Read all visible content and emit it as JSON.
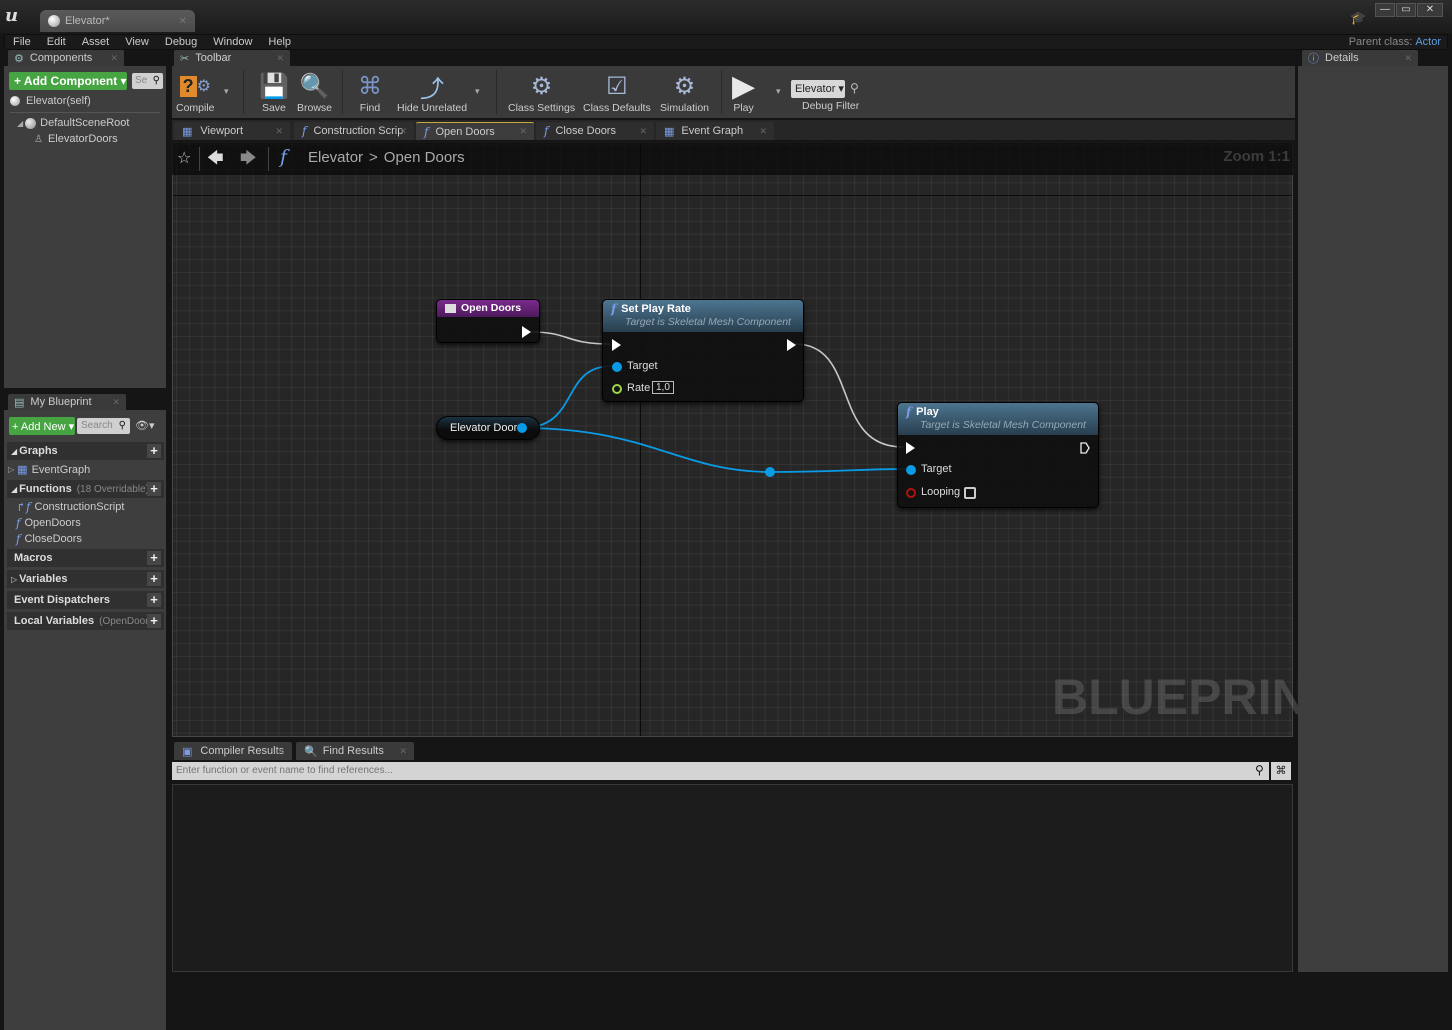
{
  "window": {
    "tab_title": "Elevator*",
    "menu": [
      "File",
      "Edit",
      "Asset",
      "View",
      "Debug",
      "Window",
      "Help"
    ],
    "parent_class_label": "Parent class:",
    "parent_class_value": "Actor"
  },
  "components": {
    "tab_label": "Components",
    "add_label": "+ Add Component ▾",
    "search_placeholder": "Se",
    "self_item": "Elevator(self)",
    "tree": [
      {
        "label": "DefaultSceneRoot",
        "icon": "scene-root-icon"
      },
      {
        "label": "ElevatorDoors",
        "icon": "skeletal-mesh-icon"
      }
    ]
  },
  "toolbar": {
    "tab_label": "Toolbar",
    "buttons": [
      {
        "label": "Compile",
        "icon": "compile-icon"
      },
      {
        "label": "Save",
        "icon": "save-icon"
      },
      {
        "label": "Browse",
        "icon": "browse-icon"
      },
      {
        "label": "Find",
        "icon": "find-icon"
      },
      {
        "label": "Hide Unrelated",
        "icon": "hide-unrelated-icon"
      },
      {
        "label": "Class Settings",
        "icon": "class-settings-icon"
      },
      {
        "label": "Class Defaults",
        "icon": "class-defaults-icon"
      },
      {
        "label": "Simulation",
        "icon": "simulation-icon"
      },
      {
        "label": "Play",
        "icon": "play-icon"
      }
    ],
    "debug_filter_value": "Elevator ▾",
    "debug_filter_label": "Debug Filter"
  },
  "doc_tabs": [
    {
      "label": "Viewport",
      "icon": "viewport-icon",
      "active": false
    },
    {
      "label": "Construction Scrip",
      "icon": "function-icon",
      "active": false
    },
    {
      "label": "Open Doors",
      "icon": "function-icon",
      "active": true
    },
    {
      "label": "Close Doors",
      "icon": "function-icon",
      "active": false
    },
    {
      "label": "Event Graph",
      "icon": "event-graph-icon",
      "active": false
    }
  ],
  "graph": {
    "breadcrumb": [
      "Elevator",
      "Open Doors"
    ],
    "breadcrumb_sep": ">",
    "zoom": "Zoom 1:1",
    "watermark": "BLUEPRINT",
    "nodes": {
      "entry": {
        "title": "Open Doors"
      },
      "set_play_rate": {
        "title": "Set Play Rate",
        "subtitle": "Target is Skeletal Mesh Component",
        "pins": {
          "target": "Target",
          "rate": "Rate",
          "rate_value": "1,0"
        }
      },
      "elevator_doors": {
        "title": "Elevator Doors"
      },
      "play": {
        "title": "Play",
        "subtitle": "Target is Skeletal Mesh Component",
        "pins": {
          "target": "Target",
          "looping": "Looping",
          "looping_checked": false
        }
      }
    },
    "colors": {
      "exec_wire": "#c8c8c8",
      "object_wire": "#0a9be6",
      "float_pin": "#9cd64a",
      "bool_pin": "#b0120e",
      "function_header": "#3b5b73",
      "event_header": "#7a2a8c"
    }
  },
  "my_blueprint": {
    "tab_label": "My Blueprint",
    "add_label": "+ Add New ▾",
    "search_placeholder": "Search",
    "sections": [
      {
        "label": "Graphs",
        "sub": "",
        "items": [
          {
            "label": "EventGraph",
            "icon": "event-graph-icon"
          }
        ]
      },
      {
        "label": "Functions",
        "sub": "(18 Overridable)",
        "items": [
          {
            "label": "ConstructionScript",
            "icon": "construction-script-icon"
          },
          {
            "label": "OpenDoors",
            "icon": "function-icon"
          },
          {
            "label": "CloseDoors",
            "icon": "function-icon"
          }
        ]
      },
      {
        "label": "Macros",
        "sub": "",
        "items": []
      },
      {
        "label": "Variables",
        "sub": "",
        "items": []
      },
      {
        "label": "Event Dispatchers",
        "sub": "",
        "items": []
      },
      {
        "label": "Local Variables",
        "sub": "(OpenDoors)",
        "items": []
      }
    ]
  },
  "bottom": {
    "tabs": [
      {
        "label": "Compiler Results",
        "icon": "compiler-results-icon"
      },
      {
        "label": "Find Results",
        "icon": "find-results-icon"
      }
    ],
    "find_placeholder": "Enter function or event name to find references..."
  },
  "details": {
    "tab_label": "Details"
  }
}
